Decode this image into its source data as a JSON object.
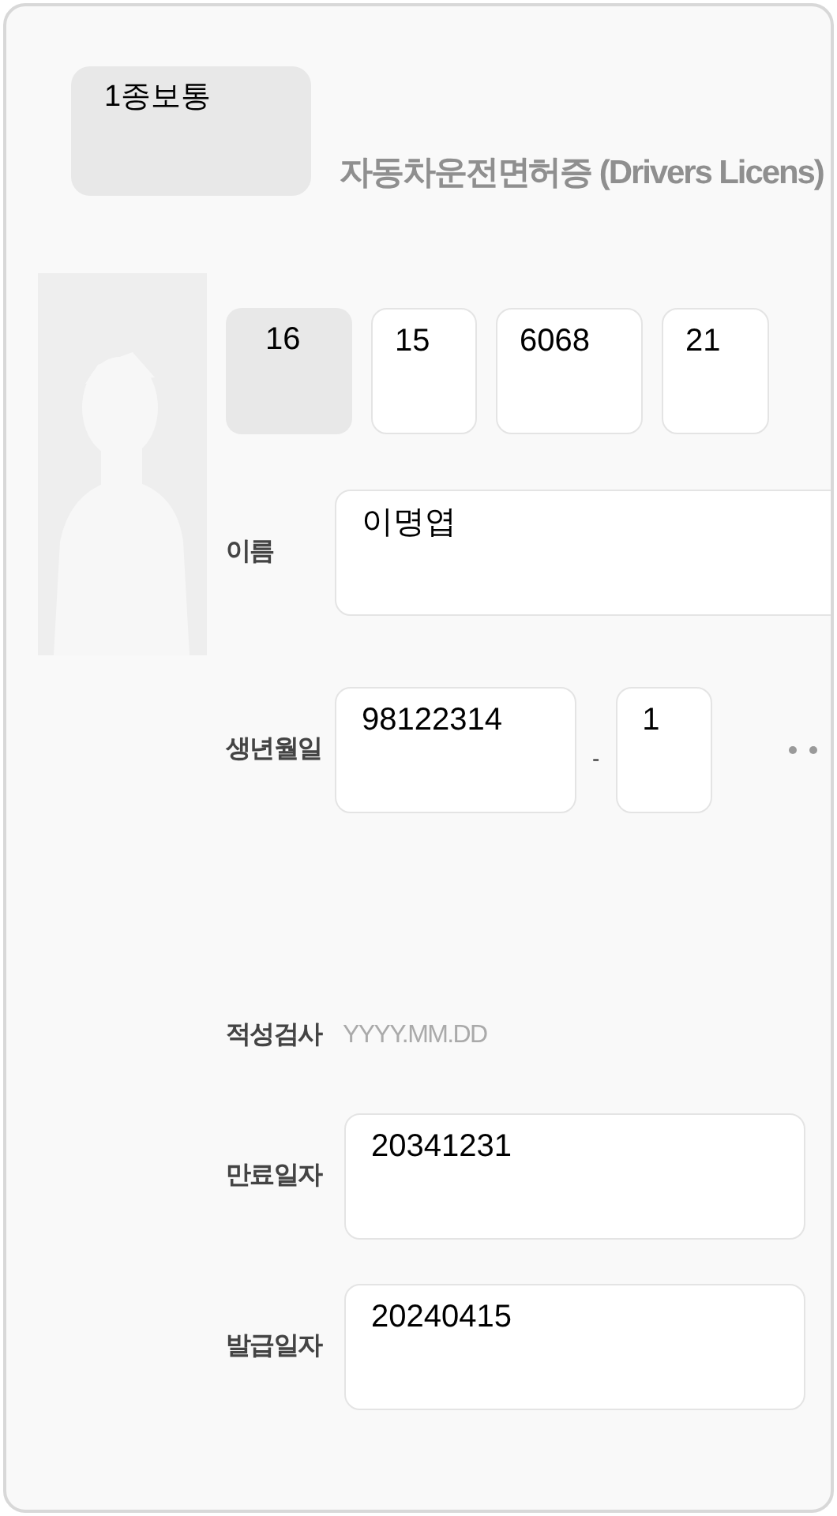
{
  "license_type": "1종보통",
  "title": "자동차운전면허증 (Drivers Licens)",
  "license_number": [
    {
      "value": "16",
      "disabled": true
    },
    {
      "value": "15",
      "disabled": false
    },
    {
      "value": "6068",
      "disabled": false
    },
    {
      "value": "21",
      "disabled": false
    }
  ],
  "fields": [
    {
      "kind": "text",
      "label": "이름",
      "value": "이명엽"
    },
    {
      "kind": "split",
      "label": "생년월일",
      "value": "98122314",
      "separator": "-",
      "value2": "1"
    },
    {
      "kind": "plain",
      "label": "적성검사",
      "placeholder": "YYYY.MM.DD"
    },
    {
      "kind": "box",
      "label": "만료일자",
      "value": "20341231"
    },
    {
      "kind": "box",
      "label": "발급일자",
      "value": "20240415"
    }
  ]
}
